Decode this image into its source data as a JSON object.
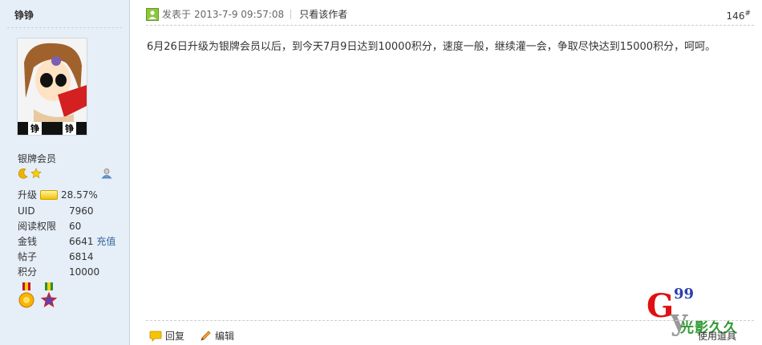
{
  "user": {
    "name": "铮铮",
    "avatar_text": [
      "铮",
      "铮"
    ],
    "rank": "银牌会员",
    "upgrade_label": "升级",
    "upgrade_percent": "28.57%",
    "upgrade_progress": 0.2857,
    "stats": [
      {
        "key": "UID",
        "value": "7960"
      },
      {
        "key": "阅读权限",
        "value": "60"
      },
      {
        "key": "金钱",
        "value": "6641",
        "link": "充值"
      },
      {
        "key": "帖子",
        "value": "6814"
      },
      {
        "key": "积分",
        "value": "10000"
      }
    ],
    "star_icons": [
      "moon-icon",
      "star-icon"
    ]
  },
  "post": {
    "posted_prefix": "发表于",
    "posted_time": "2013-7-9 09:57:08",
    "only_author": "只看该作者",
    "floor": "146",
    "floor_mark": "#",
    "content": "6月26日升级为银牌会员以后，到今天7月9日达到10000积分，速度一般，继续灌一会，争取尽快达到15000积分，呵呵。"
  },
  "actions": {
    "reply": "回复",
    "edit": "编辑",
    "tools": "使用道具"
  },
  "watermark": {
    "g": "G",
    "num": "99",
    "y": "y",
    "text": "光影久久"
  },
  "colors": {
    "sidebar_bg": "#e6eef7",
    "link": "#336699",
    "watermark_red": "#e01010",
    "watermark_green": "#2f9a2f"
  }
}
